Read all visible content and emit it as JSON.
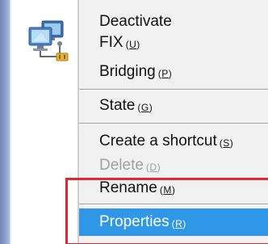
{
  "icon": {
    "name": "network-connection-icon"
  },
  "menu": {
    "items": [
      {
        "label": "Deactivate",
        "accel": ""
      },
      {
        "label": "FIX",
        "accel": "U"
      },
      {
        "label": "Bridging",
        "accel": "P"
      },
      {
        "label": "State",
        "accel": "G"
      },
      {
        "label": "Create a shortcut",
        "accel": "S"
      },
      {
        "label": "Delete",
        "accel": "D",
        "disabled": true
      },
      {
        "label": "Rename",
        "accel": "M"
      },
      {
        "label": "Properties",
        "accel": "R",
        "selected": true
      }
    ]
  },
  "colors": {
    "menu_bg": "#f1f1f1",
    "selected_bg": "#2f97e6",
    "highlight_box": "#e0262e",
    "disabled_text": "#a0a0a0"
  }
}
